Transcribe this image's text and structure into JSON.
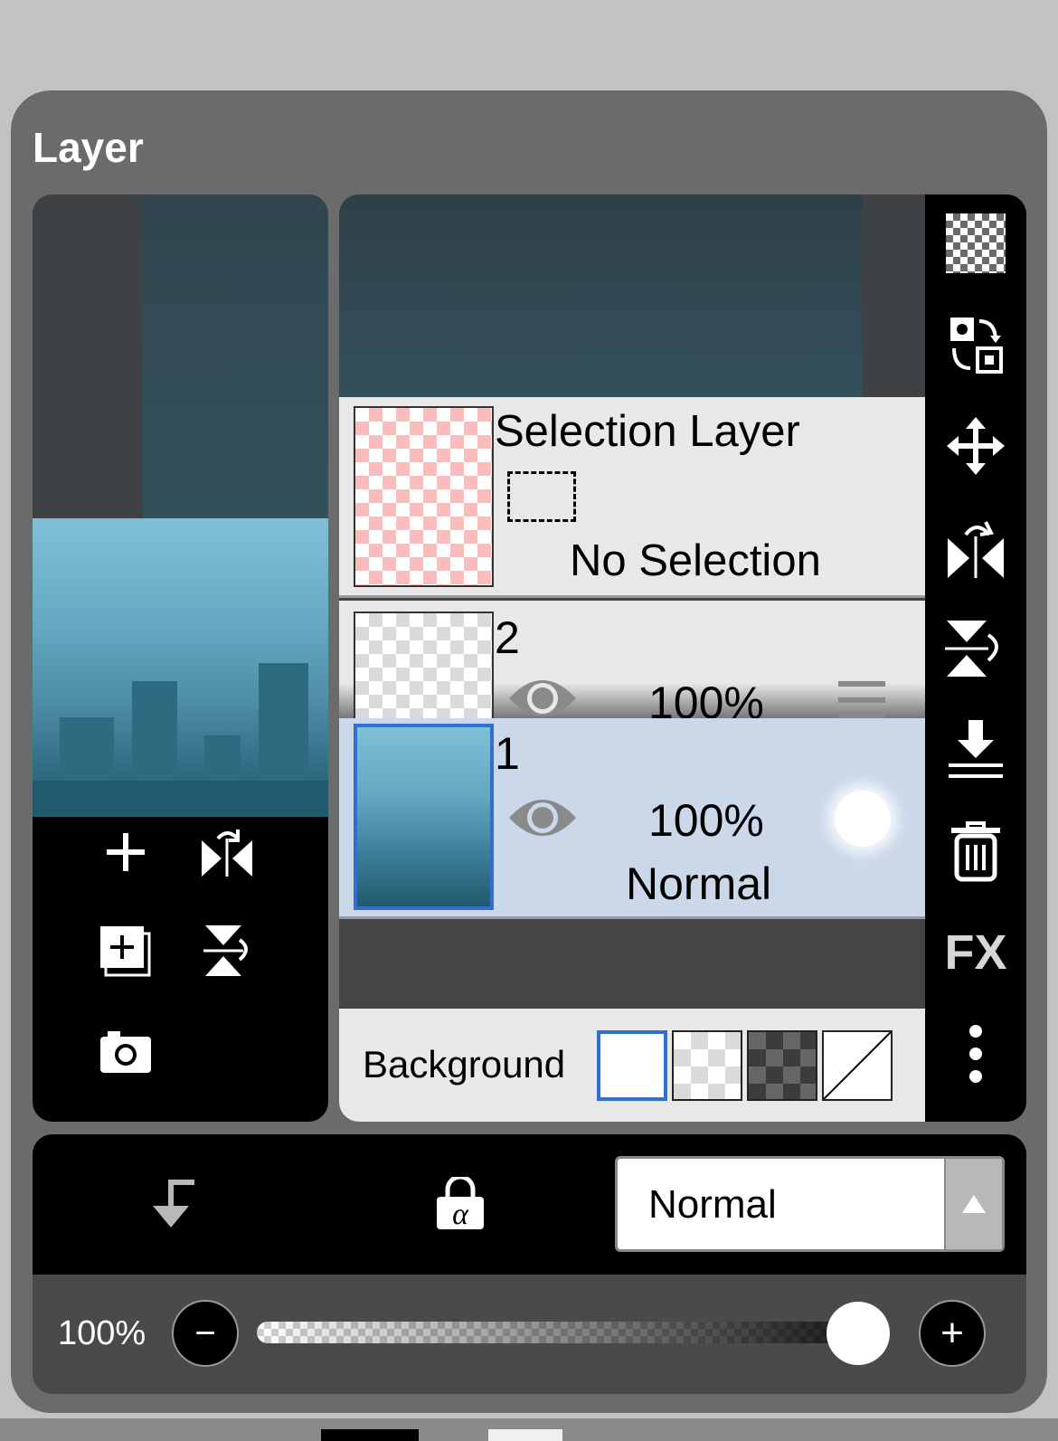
{
  "panel": {
    "title": "Layer"
  },
  "layers": [
    {
      "name": "Selection Layer",
      "status": "No Selection",
      "type": "selection"
    },
    {
      "name": "2",
      "opacity": "100%",
      "visible": true
    },
    {
      "name": "1",
      "opacity": "100%",
      "blend": "Normal",
      "visible": true,
      "selected": true
    }
  ],
  "background": {
    "label": "Background",
    "options": [
      "white",
      "checker-light",
      "checker-dark",
      "none"
    ],
    "selected": "white"
  },
  "toolbar": {
    "items": [
      "checkerboard-icon",
      "swap-layer-icon",
      "move-icon",
      "flip-horizontal-icon",
      "flip-vertical-icon",
      "merge-down-icon",
      "trash-icon",
      "fx-icon",
      "more-icon"
    ],
    "fx_label": "FX"
  },
  "preview_tools": [
    "add-layer-icon",
    "flip-horizontal-icon",
    "duplicate-layer-icon",
    "flip-vertical-icon",
    "camera-icon"
  ],
  "bottom": {
    "blend_mode": "Normal",
    "clip_icon": "clip-down-arrow-icon",
    "alpha_lock_icon": "alpha-lock-icon"
  },
  "opacity": {
    "label": "100%",
    "value": 100,
    "minus": "−",
    "plus": "+"
  },
  "colors": {
    "selected_row": "#cbd8ea",
    "accent": "#2f6fd2"
  }
}
